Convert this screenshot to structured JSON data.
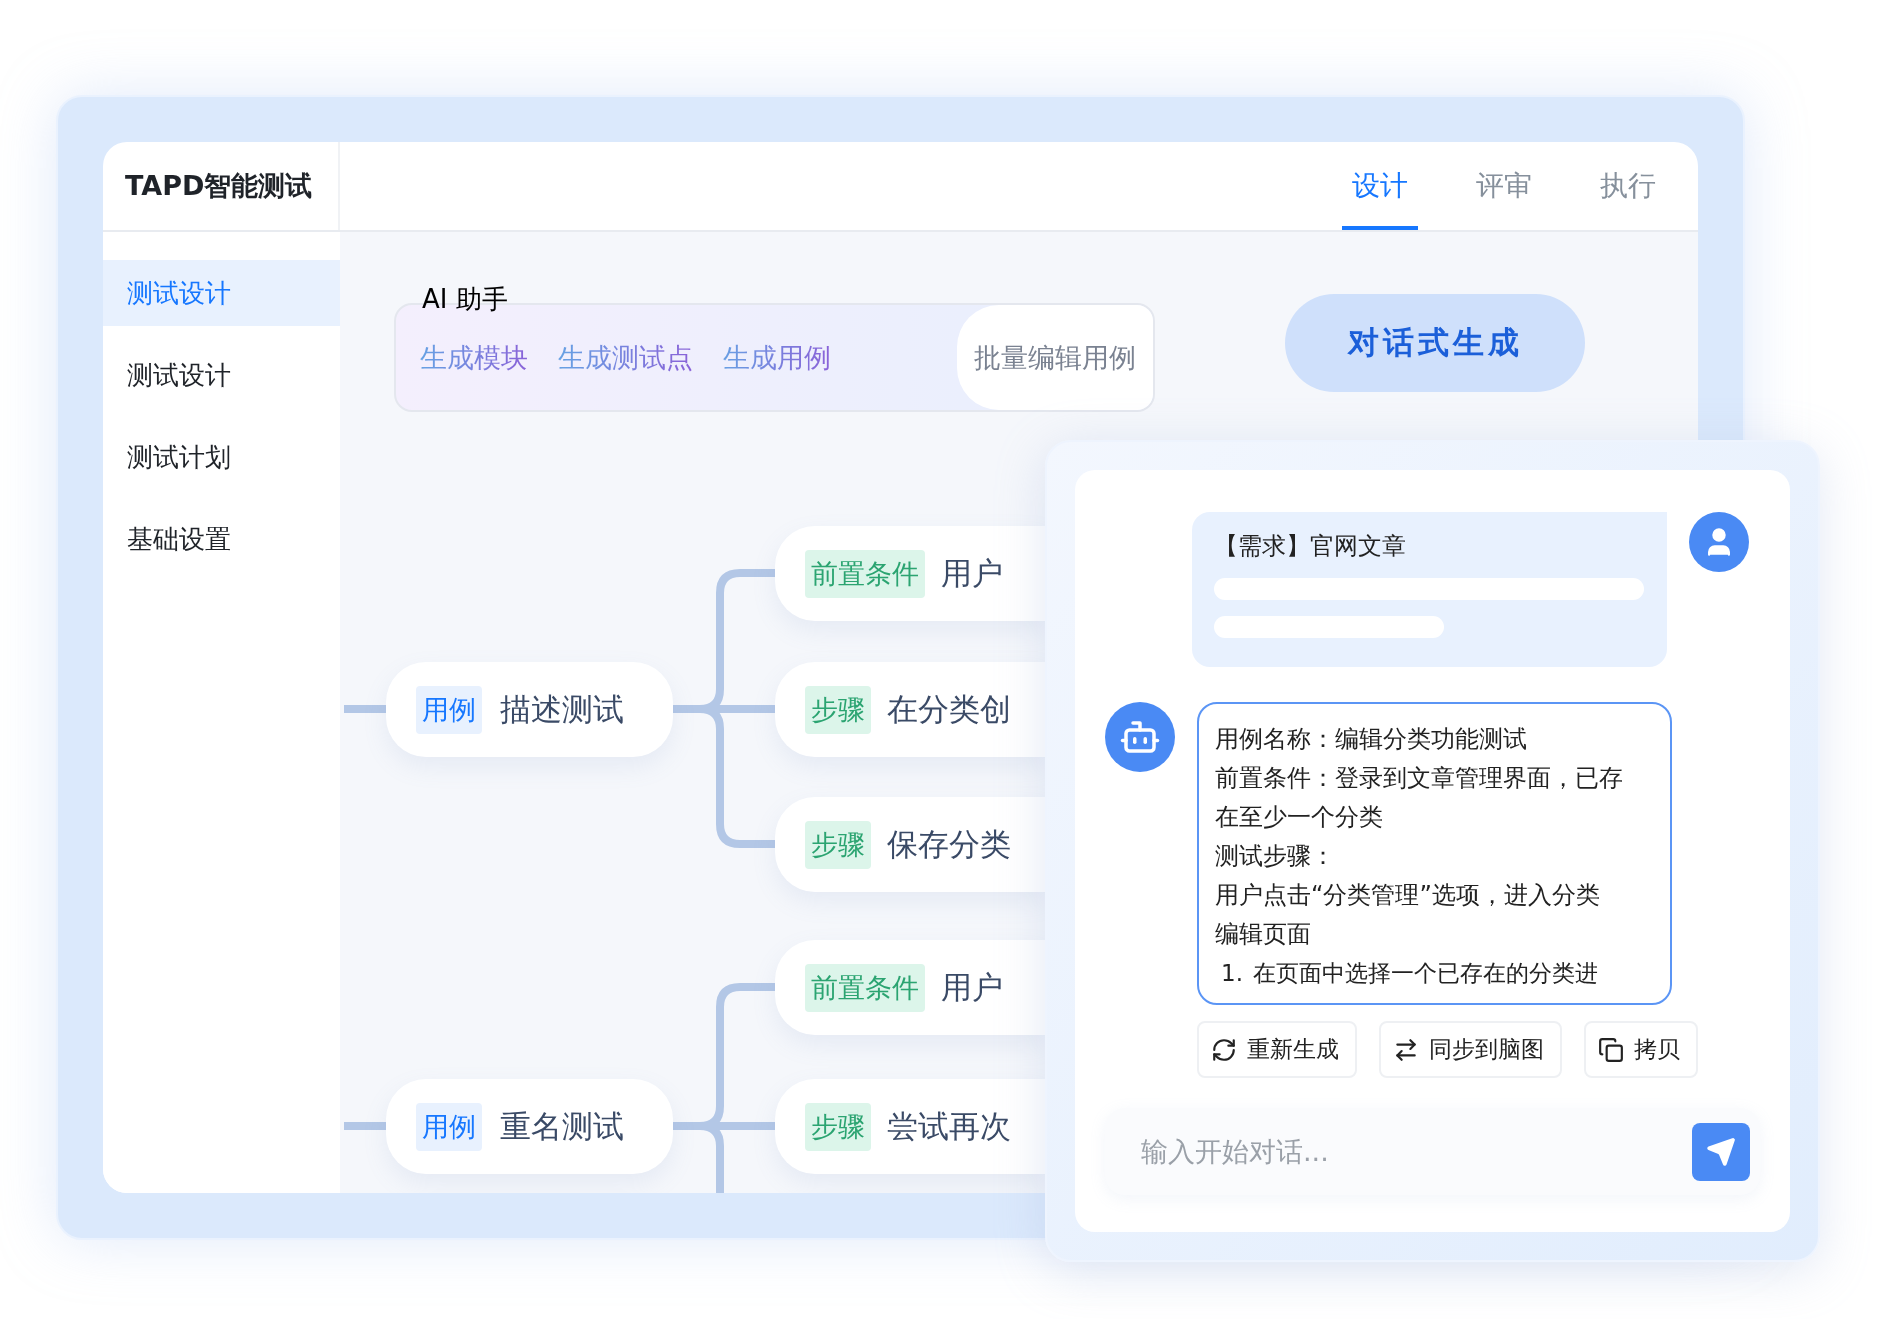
{
  "app": {
    "title": "TAPD智能测试"
  },
  "tabs": [
    {
      "label": "设计",
      "selected": true
    },
    {
      "label": "评审",
      "selected": false
    },
    {
      "label": "执行",
      "selected": false
    }
  ],
  "sidebar": {
    "items": [
      {
        "label": "测试设计",
        "selected": true
      },
      {
        "label": "测试设计",
        "selected": false
      },
      {
        "label": "测试计划",
        "selected": false
      },
      {
        "label": "基础设置",
        "selected": false
      }
    ]
  },
  "ai_assistant": {
    "label": "AI 助手",
    "actions": [
      {
        "label": "生成模块",
        "kind": "generate"
      },
      {
        "label": "生成测试点",
        "kind": "generate"
      },
      {
        "label": "生成用例",
        "kind": "generate"
      },
      {
        "label": "批量编辑用例",
        "kind": "edit"
      }
    ]
  },
  "chat_mode_button": {
    "label": "对话式生成"
  },
  "mind_map": {
    "cases": [
      {
        "tag": "用例",
        "title": "描述测试",
        "children": [
          {
            "tag": "前置条件",
            "text": "用户"
          },
          {
            "tag": "步骤",
            "text": "在分类创"
          },
          {
            "tag": "步骤",
            "text": "保存分类"
          }
        ]
      },
      {
        "tag": "用例",
        "title": "重名测试",
        "children": [
          {
            "tag": "前置条件",
            "text": "用户"
          },
          {
            "tag": "步骤",
            "text": "尝试再次"
          }
        ]
      }
    ]
  },
  "chat": {
    "messages": [
      {
        "kind": "user",
        "text": "【需求】官网文章"
      },
      {
        "kind": "bot",
        "lines": [
          "用例名称：编辑分类功能测试",
          "前置条件：登录到文章管理界面，已存在至少一个分类",
          "测试步骤：",
          "用户点击“分类管理”选项，进入分类编辑页面"
        ],
        "list": [
          {
            "number": "1.",
            "text": "在页面中选择一个已存在的分类进"
          }
        ]
      }
    ],
    "actions": [
      {
        "label": "重新生成",
        "kind": "regenerate"
      },
      {
        "label": "同步到脑图",
        "kind": "sync"
      },
      {
        "label": "拷贝",
        "kind": "copy"
      }
    ],
    "input": {
      "placeholder": "输入开始对话..."
    }
  }
}
